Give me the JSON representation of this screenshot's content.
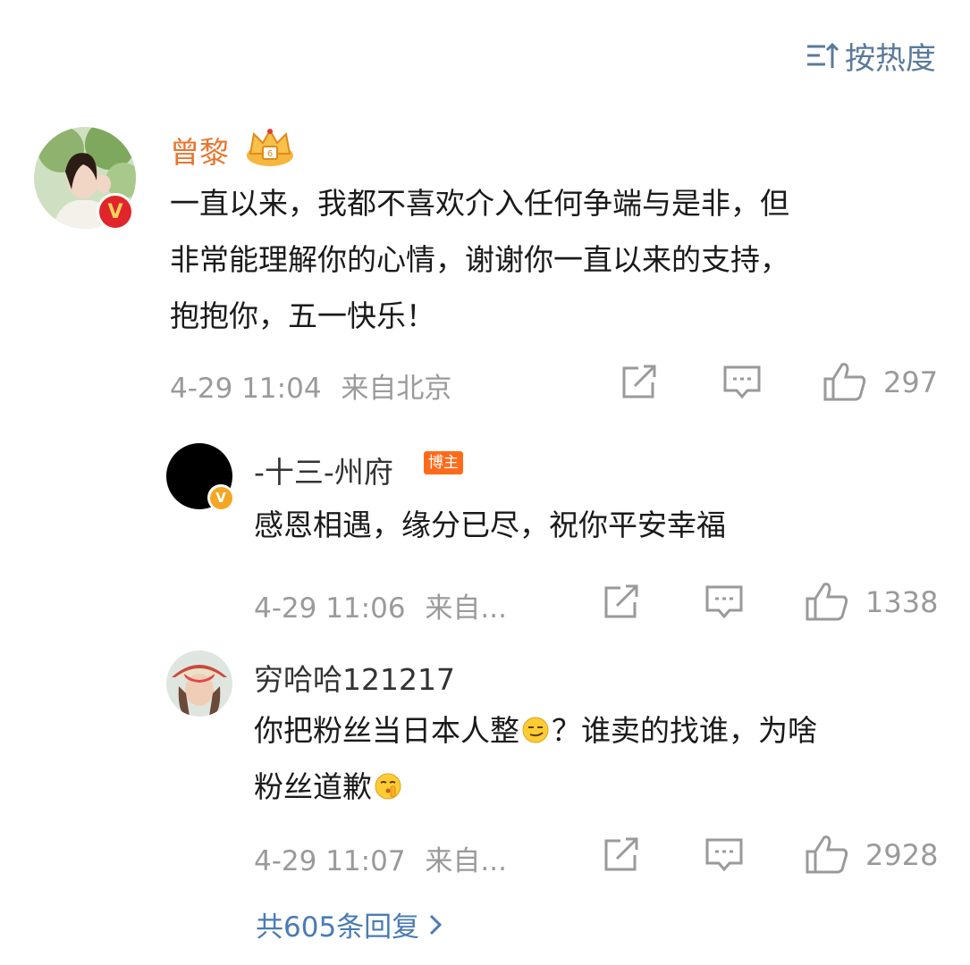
{
  "sort": {
    "label": "按热度",
    "icon": "sort-lines-icon"
  },
  "main_comment": {
    "username": "曾黎",
    "badge_icon": "crown-vip-icon",
    "verified_icon": "verified-red-v-icon",
    "text_line1": "一直以来，我都不喜欢介入任何争端与是非，但",
    "text_line2": "非常能理解你的心情，谢谢你一直以来的支持，",
    "text_line3": "抱抱你，五一快乐！",
    "time": "4-29 11:04",
    "location": "来自北京",
    "likes": "297"
  },
  "replies": [
    {
      "username": "-十三-州府",
      "tag": "博主",
      "verified_icon": "verified-gold-v-icon",
      "text_line1": "感恩相遇，缘分已尽，祝你平安幸福",
      "time": "4-29 11:06",
      "location": "来自...",
      "likes": "1338"
    },
    {
      "username": "穷哈哈121217",
      "text_line1_a": "你把粉丝当日本人整",
      "text_line1_b": "？谁卖的找谁，为啥",
      "text_line2": "粉丝道歉",
      "time": "4-29 11:07",
      "location": "来自...",
      "likes": "2928"
    }
  ],
  "more_replies": {
    "label": "共605条回复"
  },
  "colors": {
    "username_highlight": "#e8762d",
    "link_blue": "#4a7bb5",
    "meta_gray": "#9a9a9a",
    "blogger_tag": "#ff6b1a"
  }
}
